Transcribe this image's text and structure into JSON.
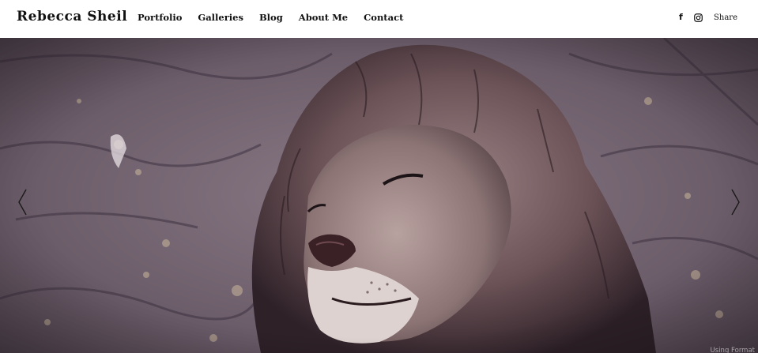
{
  "site": {
    "title": "Rebecca Sheil"
  },
  "nav": {
    "items": [
      {
        "label": "Portfolio"
      },
      {
        "label": "Galleries"
      },
      {
        "label": "Blog"
      },
      {
        "label": "About Me"
      },
      {
        "label": "Contact"
      }
    ]
  },
  "social": {
    "facebook_glyph": "f",
    "icons": [
      "facebook-icon",
      "instagram-icon"
    ],
    "share_label": "Share"
  },
  "slideshow": {
    "image_subject": "lion",
    "icons": [
      "chevron-left-icon",
      "chevron-right-icon"
    ]
  },
  "badge": {
    "text": "Using Format"
  },
  "colors": {
    "header_bg": "#ffffff",
    "text": "#111111",
    "rock": "#6f6070",
    "mane_dark": "#3a2c33",
    "mane_light": "#8a7478",
    "muzzle": "#e6dcd9"
  }
}
